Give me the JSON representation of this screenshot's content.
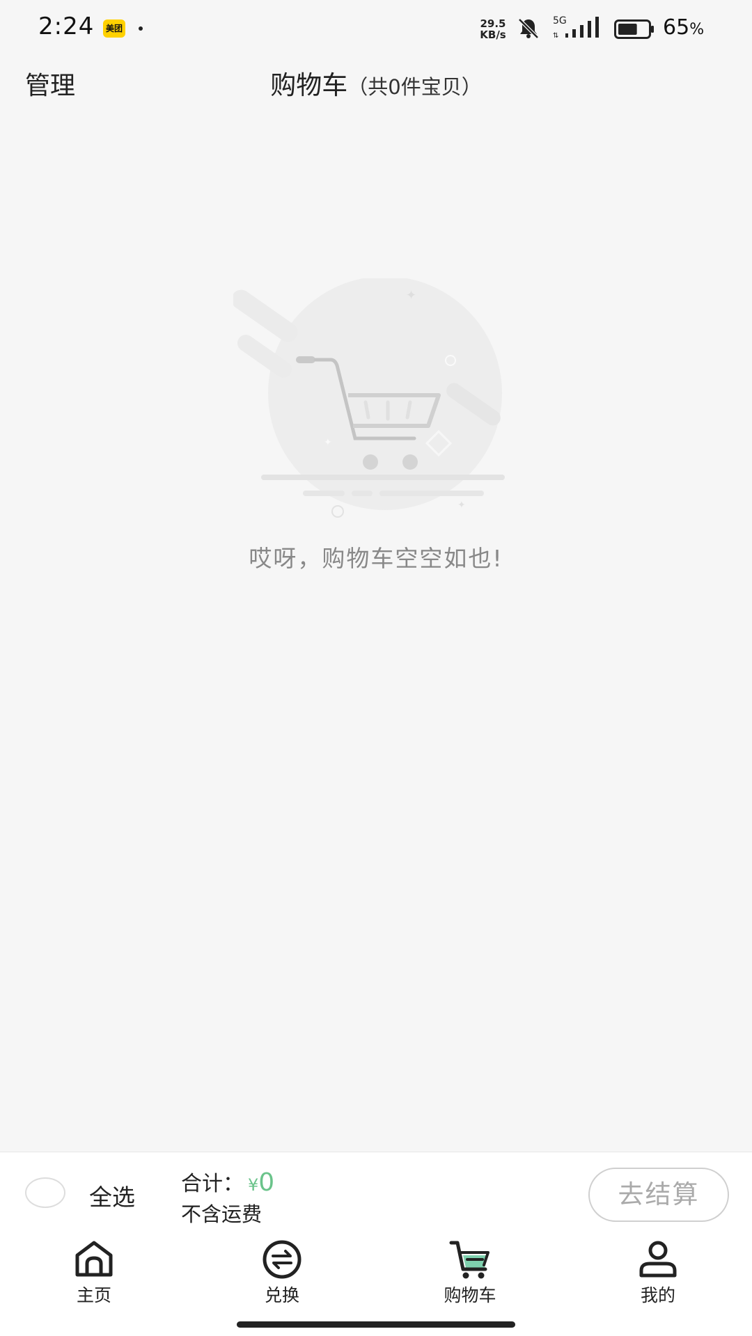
{
  "status_bar": {
    "time": "2:24",
    "meituan_badge": "美团",
    "net_speed_value": "29.5",
    "net_speed_unit": "KB/s",
    "network": "5G",
    "battery_percent": "65",
    "battery_unit": "%",
    "battery_level": 0.65
  },
  "header": {
    "manage_label": "管理",
    "title": "购物车",
    "subtitle": "（共0件宝贝）"
  },
  "empty_state": {
    "illustration_icon": "empty-cart-icon",
    "message": "哎呀，购物车空空如也!"
  },
  "checkout_bar": {
    "select_all_label": "全选",
    "select_all_checked": false,
    "total_label": "合计：",
    "currency": "¥",
    "total_amount": "0",
    "shipping_note": "不含运费",
    "checkout_label": "去结算"
  },
  "tab_bar": {
    "tabs": [
      {
        "label": "主页",
        "icon": "home-icon",
        "active": false
      },
      {
        "label": "兑换",
        "icon": "exchange-icon",
        "active": false
      },
      {
        "label": "购物车",
        "icon": "cart-icon",
        "active": true
      },
      {
        "label": "我的",
        "icon": "user-icon",
        "active": false
      }
    ]
  },
  "colors": {
    "accent": "#6ac38a",
    "background": "#f6f6f6",
    "text_muted": "#888888"
  }
}
